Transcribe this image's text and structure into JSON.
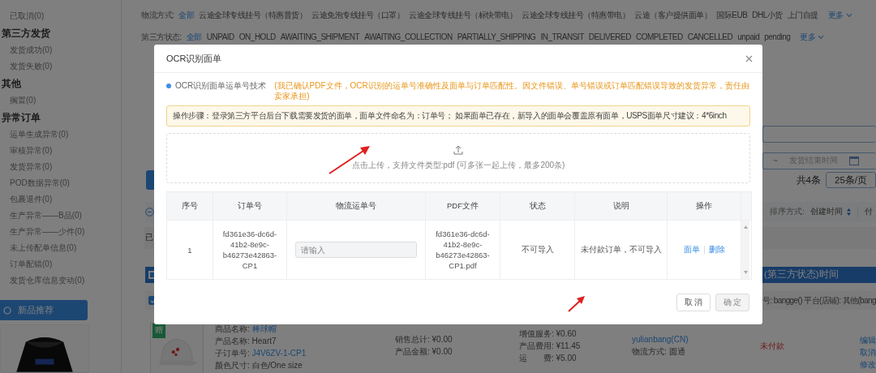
{
  "sidebar": {
    "entries": [
      {
        "kind": "item",
        "label": "已取消(0)"
      },
      {
        "kind": "heading",
        "label": "第三方发货"
      },
      {
        "kind": "item",
        "label": "发货成功(0)"
      },
      {
        "kind": "item",
        "label": "发货失败(0)"
      },
      {
        "kind": "heading",
        "label": "其他"
      },
      {
        "kind": "item",
        "label": "搁置(0)"
      },
      {
        "kind": "heading",
        "label": "异常订单"
      },
      {
        "kind": "item",
        "label": "运单生成异常(0)"
      },
      {
        "kind": "item",
        "label": "审核异常(0)"
      },
      {
        "kind": "item",
        "label": "发货异常(0)"
      },
      {
        "kind": "item",
        "label": "POD数据异常(0)"
      },
      {
        "kind": "item",
        "label": "包裹退件(0)"
      },
      {
        "kind": "item",
        "label": "生产异常——B品(0)"
      },
      {
        "kind": "item",
        "label": "生产异常——少件(0)"
      },
      {
        "kind": "item",
        "label": "未上传配单信息(0)"
      },
      {
        "kind": "item",
        "label": "订单配错(0)"
      },
      {
        "kind": "item",
        "label": "发货仓库信息变动(0)"
      }
    ],
    "promo_button": "新品推荐"
  },
  "filters": [
    {
      "label": "物流方式:",
      "more": "更多",
      "options": [
        {
          "label": "全部",
          "selected": true
        },
        {
          "label": "云途全球专线挂号（特惠普货）",
          "selected": false
        },
        {
          "label": "云途免泡专线挂号（口罩）",
          "selected": false
        },
        {
          "label": "云途全球专线挂号（标快带电）",
          "selected": false
        },
        {
          "label": "云途全球专线挂号（特惠带电）",
          "selected": false
        },
        {
          "label": "云途（客户提供面单）",
          "selected": false
        },
        {
          "label": "国际EUB",
          "selected": false
        },
        {
          "label": "DHL小货",
          "selected": false
        },
        {
          "label": "上门自提",
          "selected": false
        }
      ]
    },
    {
      "label": "第三方状态:",
      "more": "更多",
      "options": [
        {
          "label": "全部",
          "selected": true
        },
        {
          "label": "UNPAID",
          "selected": false
        },
        {
          "label": "ON_HOLD",
          "selected": false
        },
        {
          "label": "AWAITING_SHIPMENT",
          "selected": false
        },
        {
          "label": "AWAITING_COLLECTION",
          "selected": false
        },
        {
          "label": "PARTIALLY_SHIPPING",
          "selected": false
        },
        {
          "label": "IN_TRANSIT",
          "selected": false
        },
        {
          "label": "DELIVERED",
          "selected": false
        },
        {
          "label": "COMPLETED",
          "selected": false
        },
        {
          "label": "CANCELLED",
          "selected": false
        },
        {
          "label": "unpaid",
          "selected": false
        },
        {
          "label": "pending",
          "selected": false
        }
      ]
    }
  ],
  "date_range": {
    "separator": "~",
    "end_placeholder": "发货结束时间"
  },
  "pager": {
    "total": "共4条",
    "page_size": "25条/页"
  },
  "sort": {
    "label": "排序方式:",
    "value": "创建时间",
    "next": "付"
  },
  "list": {
    "tab": "已",
    "select_all_checked": true,
    "header_text": "(第三方状态)时间",
    "order_checked": true,
    "order_line": "号: bangge() 平台(店铺): 其他(bang"
  },
  "product": {
    "badge": "赠",
    "lines": [
      {
        "label": "商品名称:",
        "value": "棒球帽",
        "link": true
      },
      {
        "label": "产品名称:",
        "value": "Heart7",
        "link": false
      },
      {
        "label": "子订单号:",
        "value": "J4V6ZV-1-CP1",
        "link": true
      },
      {
        "label": "颜色尺寸:",
        "value": "白色/One size",
        "link": false
      }
    ],
    "sales": [
      {
        "label": "销售总计:",
        "value": "¥0.00"
      },
      {
        "label": "产品金额:",
        "value": "¥0.00"
      }
    ],
    "fees": [
      {
        "label": "增值服务:",
        "value": "¥0.60"
      },
      {
        "label": "产品费用:",
        "value": "¥11.45"
      },
      {
        "label": "运　　费:",
        "value": "¥5.00"
      }
    ],
    "customer": "yulianbang(CN)",
    "shipping": "物流方式: 圆通",
    "status": "未付款",
    "actions": [
      "编辑",
      "取消",
      "修改"
    ]
  },
  "modal": {
    "title": "OCR识别面单",
    "feature_label": "OCR识别面单运单号技术",
    "feature_note": "(我已确认PDF文件，OCR识别的运单号准确性及面单与订单匹配性。因文件错误、单号错误或订单匹配错误导致的发货异常，责任由卖家承担)",
    "steps": "操作步骤：登录第三方平台后台下载需要发货的面单，面单文件命名为：订单号； 如果面单已存在，新导入的面单会覆盖原有面单，USPS面单尺寸建议：4*6inch",
    "upload_hint": "点击上传，支持文件类型:pdf (可多张一起上传，最多200条)",
    "table": {
      "columns": [
        "序号",
        "订单号",
        "物流运单号",
        "PDF文件",
        "状态",
        "说明",
        "操作"
      ],
      "rows": [
        {
          "index": "1",
          "order_no": "fd361e36-dc6d-41b2-8e9c-b46273e42863-CP1",
          "tracking_placeholder": "请输入",
          "pdf": "fd361e36-dc6d-41b2-8e9c-b46273e42863-CP1.pdf",
          "status": "不可导入",
          "note": "未付款订单，不可导入",
          "actions": [
            "面单",
            "删除"
          ]
        }
      ]
    },
    "buttons": [
      {
        "label": "取 消",
        "disabled": false
      },
      {
        "label": "确 定",
        "disabled": true
      }
    ]
  }
}
